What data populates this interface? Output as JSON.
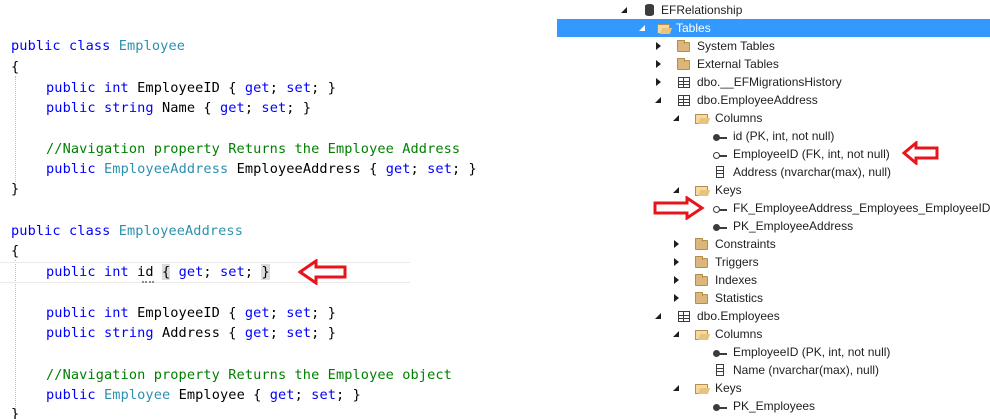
{
  "code": {
    "employee_class": {
      "kw_public": "public",
      "kw_class": "class",
      "name": "Employee",
      "open_brace": "{",
      "close_brace": "}",
      "prop1": {
        "mods": "public int",
        "text": " EmployeeID { ",
        "get": "get",
        "sep": "; ",
        "set": "set",
        "end": "; }"
      },
      "prop2": {
        "mods": "public string",
        "text": " Name { ",
        "get": "get",
        "sep": "; ",
        "set": "set",
        "end": "; }"
      },
      "comment": "//Navigation property Returns the Employee Address",
      "nav": {
        "mod": "public",
        "type": "EmployeeAddress",
        "text": " EmployeeAddress { ",
        "get": "get",
        "sep": "; ",
        "set": "set",
        "end": "; }"
      }
    },
    "address_class": {
      "kw_public": "public",
      "kw_class": "class",
      "name": "EmployeeAddress",
      "open_brace": "{",
      "close_brace": "}",
      "prop_id": {
        "mods": "public int",
        "name": " id ",
        "lbrace": "{",
        "get": " get",
        "sep": "; ",
        "set": "set",
        "mid": "; ",
        "rbrace": "}"
      },
      "prop1": {
        "mods": "public int",
        "text": " EmployeeID { ",
        "get": "get",
        "sep": "; ",
        "set": "set",
        "end": "; }"
      },
      "prop2": {
        "mods": "public string",
        "text": " Address { ",
        "get": "get",
        "sep": "; ",
        "set": "set",
        "end": "; }"
      },
      "comment": "//Navigation property Returns the Employee object",
      "nav": {
        "mod": "public",
        "type": "Employee",
        "text": " Employee { ",
        "get": "get",
        "sep": "; ",
        "set": "set",
        "end": "; }"
      }
    }
  },
  "colors": {
    "keyword": "#0000ff",
    "type": "#2b91af",
    "comment": "#008000",
    "selection": "#3399ff",
    "arrow": "#e8141b"
  },
  "tree": {
    "database": "EFRelationship",
    "tables": "Tables",
    "system_tables": "System Tables",
    "external_tables": "External Tables",
    "migrations": "dbo.__EFMigrationsHistory",
    "emp_address": {
      "name": "dbo.EmployeeAddress",
      "columns": "Columns",
      "col_id": "id (PK, int, not null)",
      "col_employeeid": "EmployeeID (FK, int, not null)",
      "col_address": "Address (nvarchar(max), null)",
      "keys": "Keys",
      "fk": "FK_EmployeeAddress_Employees_EmployeeID",
      "pk": "PK_EmployeeAddress",
      "constraints": "Constraints",
      "triggers": "Triggers",
      "indexes": "Indexes",
      "statistics": "Statistics"
    },
    "employees": {
      "name": "dbo.Employees",
      "columns": "Columns",
      "col_employeeid": "EmployeeID (PK, int, not null)",
      "col_name": "Name (nvarchar(max), null)",
      "keys": "Keys",
      "pk": "PK_Employees"
    }
  },
  "icons": [
    "expand-toggle-icon",
    "collapse-toggle-icon",
    "database-icon",
    "folder-icon",
    "table-icon",
    "primary-key-icon",
    "foreign-key-icon",
    "column-icon",
    "red-arrow-icon"
  ]
}
